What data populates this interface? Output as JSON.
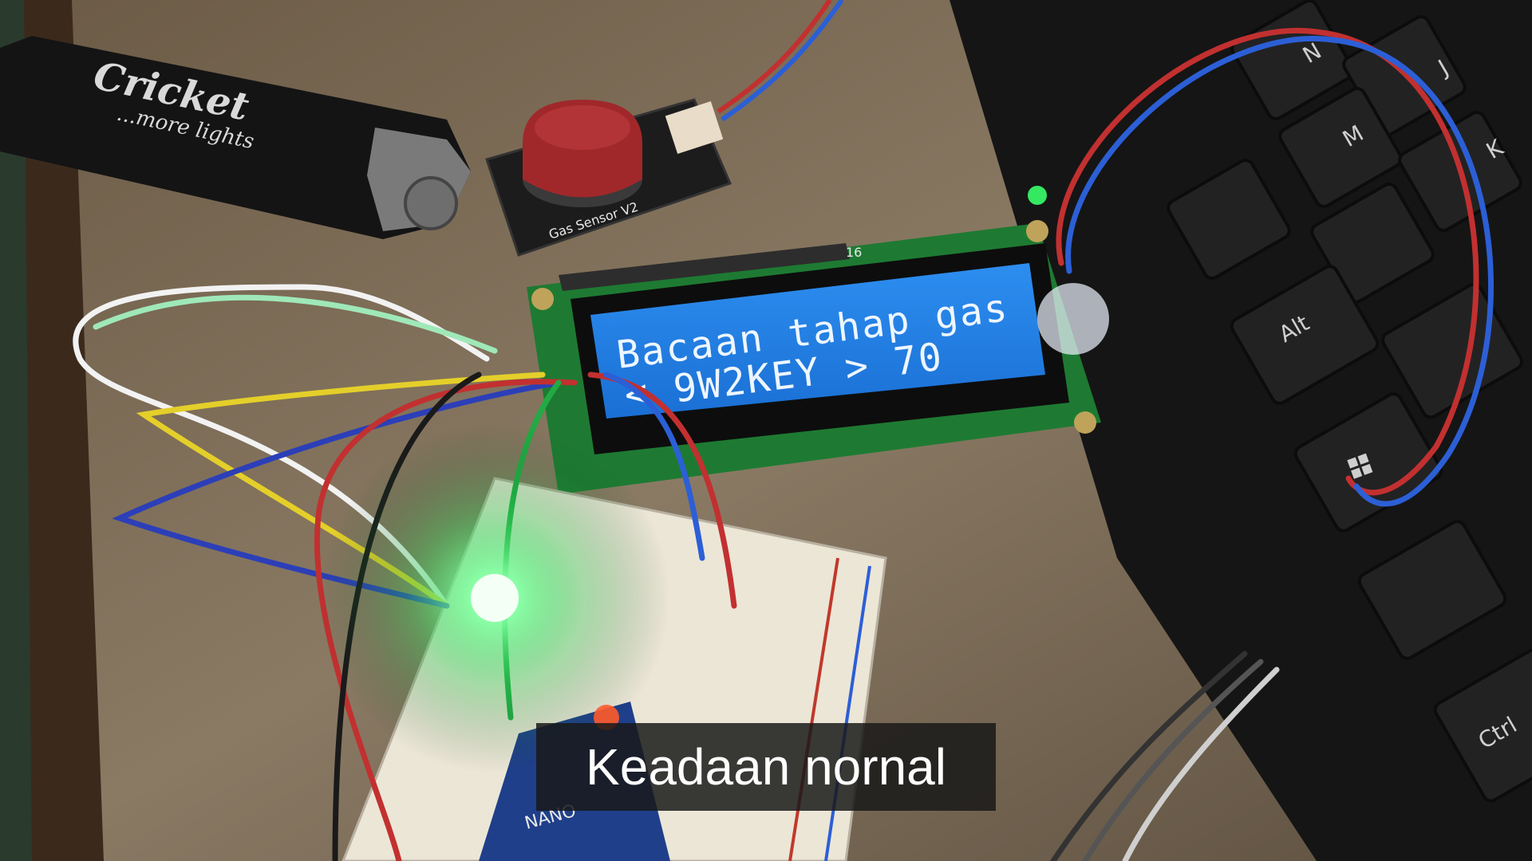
{
  "lighter": {
    "brand": "Cricket",
    "slogan": "...more lights"
  },
  "gas_sensor": {
    "label": "Gas Sensor V2"
  },
  "lcd": {
    "line1": "Bacaan tahap gas",
    "line2": "< 9W2KEY >  70",
    "pin_label": "16"
  },
  "keyboard": {
    "keys": [
      "N",
      "M",
      "J",
      "K",
      "Alt",
      "Ctrl"
    ]
  },
  "arduino": {
    "label": "NANO"
  },
  "subtitle": {
    "text": "Keadaan nornal"
  }
}
